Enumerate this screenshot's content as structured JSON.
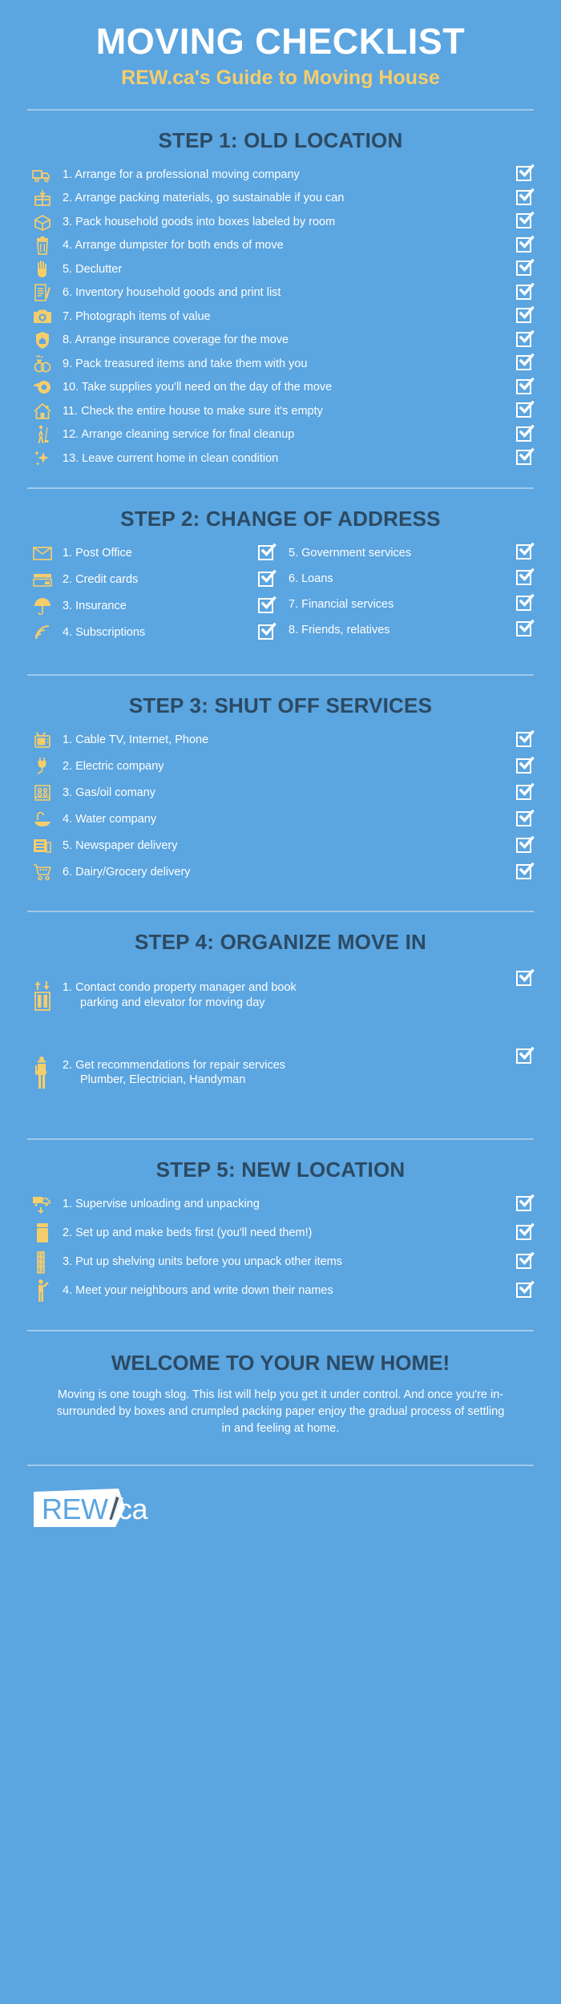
{
  "header": {
    "title": "MOVING CHECKLIST",
    "subtitle": "REW.ca's Guide to Moving House"
  },
  "colors": {
    "background": "#5ba5e0",
    "heading": "#2c4a63",
    "accent": "#f5cd6b",
    "text": "#ffffff",
    "divider": "#9fcaea"
  },
  "steps": [
    {
      "heading": "STEP 1: OLD LOCATION",
      "layout": "single",
      "items": [
        {
          "text": "1. Arrange for a professional moving  company",
          "icon": "moving-truck-icon"
        },
        {
          "text": "2. Arrange packing materials, go sustainable if you can",
          "icon": "packing-box-icon"
        },
        {
          "text": "3. Pack household goods into boxes labeled by room",
          "icon": "open-box-icon"
        },
        {
          "text": "4. Arrange dumpster for both ends of move",
          "icon": "trash-bin-icon"
        },
        {
          "text": "5. Declutter",
          "icon": "hand-icon"
        },
        {
          "text": "6. Inventory household goods and print list",
          "icon": "clipboard-pen-icon"
        },
        {
          "text": "7. Photograph items of value",
          "icon": "camera-icon"
        },
        {
          "text": "8. Arrange insurance coverage for the move",
          "icon": "shield-home-icon"
        },
        {
          "text": "9. Pack treasured items and take them with you",
          "icon": "rings-icon"
        },
        {
          "text": "10. Take supplies you'll need on the day of the move",
          "icon": "tape-roll-icon"
        },
        {
          "text": "11. Check the entire house to make sure it's empty",
          "icon": "house-icon"
        },
        {
          "text": "12. Arrange cleaning service for final cleanup",
          "icon": "mop-person-icon"
        },
        {
          "text": "13. Leave current home in clean condition",
          "icon": "sparkle-icon"
        }
      ]
    },
    {
      "heading": "STEP 2: CHANGE OF ADDRESS",
      "layout": "two-column",
      "left_items": [
        {
          "text": "1. Post Office",
          "icon": "envelope-icon"
        },
        {
          "text": "2. Credit cards",
          "icon": "credit-card-icon"
        },
        {
          "text": "3. Insurance",
          "icon": "umbrella-icon"
        },
        {
          "text": "4. Subscriptions",
          "icon": "rss-icon"
        }
      ],
      "right_items": [
        {
          "text": "5. Government services",
          "icon": ""
        },
        {
          "text": "6. Loans",
          "icon": ""
        },
        {
          "text": "7. Financial services",
          "icon": ""
        },
        {
          "text": "8. Friends, relatives",
          "icon": ""
        }
      ]
    },
    {
      "heading": "STEP 3: SHUT OFF SERVICES",
      "layout": "single",
      "items": [
        {
          "text": "1. Cable TV, Internet, Phone",
          "icon": "television-icon"
        },
        {
          "text": "2. Electric company",
          "icon": "plug-icon"
        },
        {
          "text": "3. Gas/oil comany",
          "icon": "stove-icon"
        },
        {
          "text": "4. Water company",
          "icon": "sink-tap-icon"
        },
        {
          "text": "5. Newspaper delivery",
          "icon": "newspaper-icon"
        },
        {
          "text": "6. Dairy/Grocery delivery",
          "icon": "shopping-cart-icon"
        }
      ]
    },
    {
      "heading": "STEP 4: ORGANIZE MOVE IN",
      "layout": "single-tall",
      "items": [
        {
          "line1": "1. Contact condo property manager and book",
          "line2": "parking and elevator for moving day",
          "icon": "elevator-icon"
        },
        {
          "line1": "2. Get recommendations for repair services",
          "line2": "Plumber, Electrician, Handyman",
          "icon": "handyman-icon"
        }
      ]
    },
    {
      "heading": "STEP 5: NEW LOCATION",
      "layout": "single",
      "items": [
        {
          "text": "1. Supervise unloading and unpacking",
          "icon": "unloading-truck-icon"
        },
        {
          "text": "2. Set up and make beds first (you'll need them!)",
          "icon": "bed-icon"
        },
        {
          "text": "3. Put up shelving units before you unpack other items",
          "icon": "shelving-icon"
        },
        {
          "text": "4. Meet your neighbours and write down their names",
          "icon": "person-wave-icon"
        }
      ]
    }
  ],
  "footer": {
    "welcome": "WELCOME TO YOUR NEW HOME!",
    "blurb": "Moving is one tough slog. This list will help you get it under control. And once you're in-surrounded by boxes and crumpled packing paper enjoy the gradual process of settling in and feeling at home.",
    "logo": {
      "brand": "REW",
      "domain": ".ca"
    }
  }
}
